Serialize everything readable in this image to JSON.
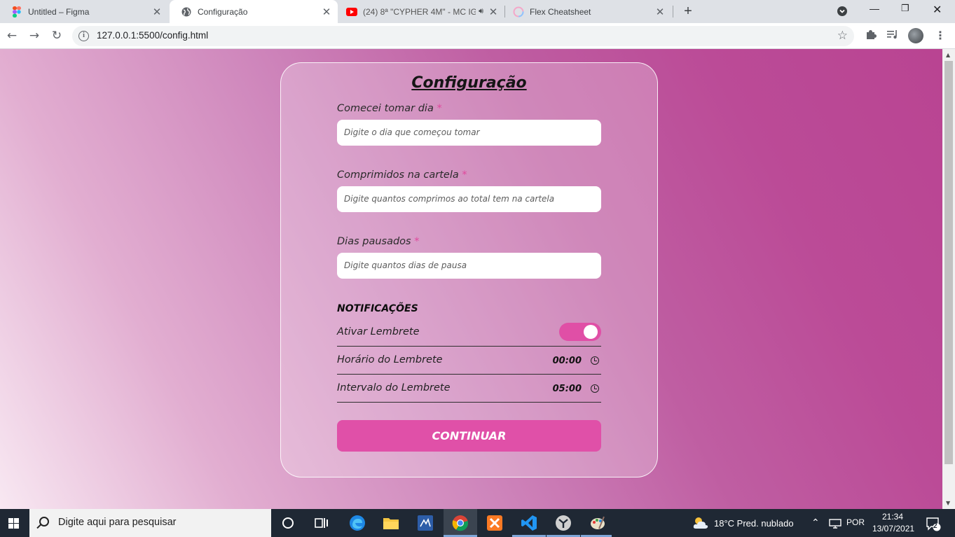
{
  "browser": {
    "tabs": [
      {
        "title": "Untitled – Figma",
        "icon": "figma-icon",
        "active": false
      },
      {
        "title": "Configuração",
        "icon": "globe-icon",
        "active": true
      },
      {
        "title": "(24) 8ª \"CYPHER 4M\" - MC IG",
        "icon": "youtube-icon",
        "active": false
      },
      {
        "title": "Flex Cheatsheet",
        "icon": "flex-icon",
        "active": false
      }
    ],
    "url": "127.0.0.1:5500/config.html"
  },
  "page": {
    "title": "Configuração",
    "fields": [
      {
        "label": "Comecei tomar dia",
        "required_mark": "*",
        "placeholder": "Digite o dia que começou tomar"
      },
      {
        "label": "Comprimidos na cartela",
        "required_mark": "*",
        "placeholder": "Digite quantos comprimos ao total tem na cartela"
      },
      {
        "label": "Dias pausados",
        "required_mark": "*",
        "placeholder": "Digite quantos dias de pausa"
      }
    ],
    "notifications": {
      "title": "NOTIFICAÇÕES",
      "reminder_label": "Ativar Lembrete",
      "reminder_enabled": true,
      "time_label": "Horário do Lembrete",
      "time_value": "00:00",
      "interval_label": "Intervalo do Lembrete",
      "interval_value": "05:00"
    },
    "continue_label": "CONTINUAR"
  },
  "colors": {
    "accent": "#e050a8",
    "required": "#e0489c"
  },
  "taskbar": {
    "search_placeholder": "Digite aqui para pesquisar",
    "weather": "18°C  Pred. nublado",
    "language": "POR",
    "time": "21:34",
    "date": "13/07/2021",
    "notification_count": "2"
  }
}
